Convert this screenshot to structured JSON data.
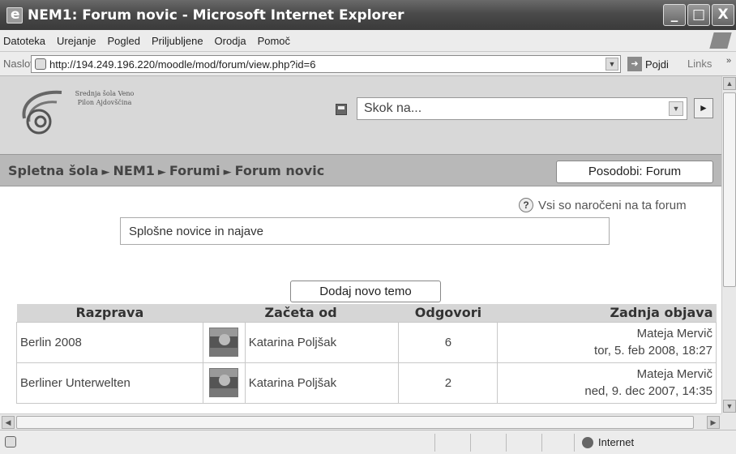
{
  "window": {
    "title": "NEM1: Forum novic - Microsoft Internet Explorer",
    "buttons": [
      "_",
      "□",
      "X"
    ]
  },
  "menu": {
    "items": [
      "Datoteka",
      "Urejanje",
      "Pogled",
      "Priljubljene",
      "Orodja",
      "Pomoč"
    ]
  },
  "address": {
    "label": "Naslov",
    "url": "http://194.249.196.220/moodle/mod/forum/view.php?id=6",
    "go": "Pojdi",
    "links": "Links",
    "more": "»"
  },
  "header": {
    "school_name": "Srednja šola Veno Pilon Ajdovščina",
    "jump_placeholder": "Skok na...",
    "jump_go": "►"
  },
  "navbar": {
    "breadcrumb": [
      "Spletna šola",
      "NEM1",
      "Forumi",
      "Forum novic"
    ],
    "separator": "►",
    "update_button": "Posodobi: Forum"
  },
  "forum": {
    "help_glyph": "?",
    "subscribed_text": "Vsi so naročeni na ta forum",
    "intro": "Splošne novice in najave",
    "add_topic_button": "Dodaj novo temo",
    "columns": [
      "Razprava",
      "Začeta od",
      "Odgovori",
      "Zadnja objava"
    ],
    "rows": [
      {
        "discussion": "Berlin 2008",
        "started_by": "Katarina Poljšak",
        "replies": "6",
        "last_author": "Mateja Mervič",
        "last_date": "tor, 5. feb 2008, 18:27"
      },
      {
        "discussion": "Berliner Unterwelten",
        "started_by": "Katarina Poljšak",
        "replies": "2",
        "last_author": "Mateja Mervič",
        "last_date": "ned, 9. dec 2007, 14:35"
      }
    ]
  },
  "status": {
    "zone": "Internet"
  }
}
